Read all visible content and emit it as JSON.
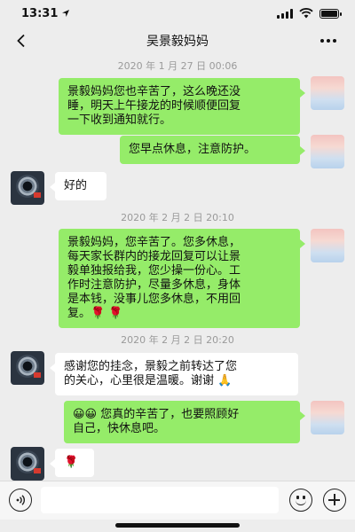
{
  "status_bar": {
    "time": "13:31",
    "location_icon": "location-arrow-icon",
    "signal_icon": "cellular-signal-icon",
    "wifi_icon": "wifi-icon",
    "battery_icon": "battery-icon"
  },
  "nav": {
    "back_icon": "chevron-left-icon",
    "title": "吴景毅妈妈",
    "more_icon": "more-dots-icon"
  },
  "messages": [
    {
      "type": "timestamp",
      "text": "2020 年 1 月 27 日 00:06"
    },
    {
      "type": "outgoing",
      "lines": [
        "景毅妈妈您也辛苦了，这么晚还没",
        "睡，明天上午接龙的时候顺便回复",
        "一下收到通知就行。"
      ]
    },
    {
      "type": "outgoing",
      "text": "您早点休息，注意防护。"
    },
    {
      "type": "incoming",
      "text": "好的"
    },
    {
      "type": "timestamp",
      "text": "2020 年 2 月 2 日 20:10"
    },
    {
      "type": "outgoing",
      "lines": [
        "景毅妈妈，您辛苦了。您多休息，",
        "每天家长群内的接龙回复可以让景",
        "毅单独报给我，您少操一份心。工",
        "作时注意防护，尽量多休息，身体",
        "是本钱，没事儿您多休息，不用回",
        "复。🌹 🌹"
      ]
    },
    {
      "type": "timestamp",
      "text": "2020 年 2 月 2 日 20:20"
    },
    {
      "type": "incoming",
      "lines": [
        "感谢您的挂念，景毅之前转达了您",
        "的关心，心里很是温暖。谢谢 🙏"
      ]
    },
    {
      "type": "outgoing",
      "lines": [
        "😀😀 您真的辛苦了，也要照顾好",
        "自己，快休息吧。"
      ]
    },
    {
      "type": "incoming",
      "text": "🌹"
    }
  ],
  "input_bar": {
    "voice_icon": "voice-icon",
    "text_value": "",
    "emoji_icon": "emoji-icon",
    "plus_icon": "plus-icon"
  },
  "colors": {
    "chat_background": "#ededed",
    "outgoing_bubble": "#95ec69",
    "incoming_bubble": "#ffffff",
    "timestamp_text": "#9a9a9a"
  }
}
